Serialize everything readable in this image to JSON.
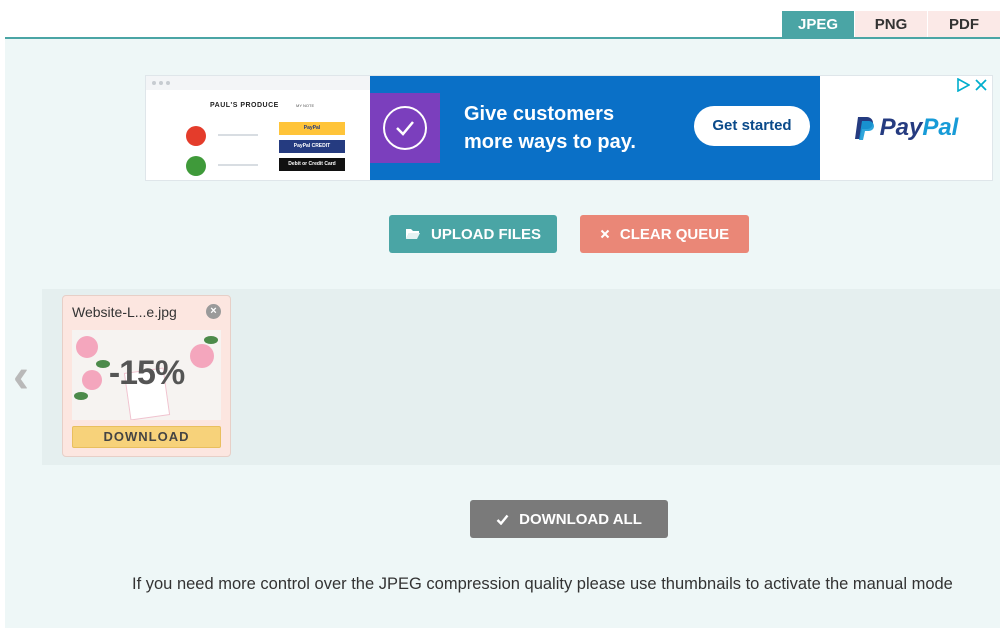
{
  "format_tabs": [
    {
      "label": "JPEG",
      "active": true
    },
    {
      "label": "PNG",
      "active": false
    },
    {
      "label": "PDF",
      "active": false
    }
  ],
  "ad": {
    "store_title": "PAUL'S PRODUCE",
    "store_sub": "MY NOTE",
    "pay_chips": [
      "PayPal",
      "PayPal CREDIT",
      "Debit or Credit Card"
    ],
    "headline_line1": "Give customers",
    "headline_line2": "more ways to pay.",
    "cta_label": "Get started",
    "logo_pay": "Pay",
    "logo_pal": "Pal",
    "brand_color": "#0a70c7",
    "icons": [
      "adchoices-icon",
      "close-icon",
      "check-circle-icon",
      "paypal-p-icon"
    ]
  },
  "actions": {
    "upload_label": "UPLOAD FILES",
    "clear_label": "CLEAR QUEUE",
    "download_all_label": "DOWNLOAD ALL"
  },
  "queue": {
    "files": [
      {
        "name": "Website-L...e.jpg",
        "savings": "-15%",
        "download_label": "DOWNLOAD"
      }
    ]
  },
  "info_text": "If you need more control over the JPEG compression quality please use thumbnails to activate the manual mode",
  "colors": {
    "accent": "#4aa5a5",
    "clear": "#ea8777",
    "download_all": "#7a7a7a",
    "download": "#f7d27a",
    "panel_bg": "#eef7f7"
  }
}
